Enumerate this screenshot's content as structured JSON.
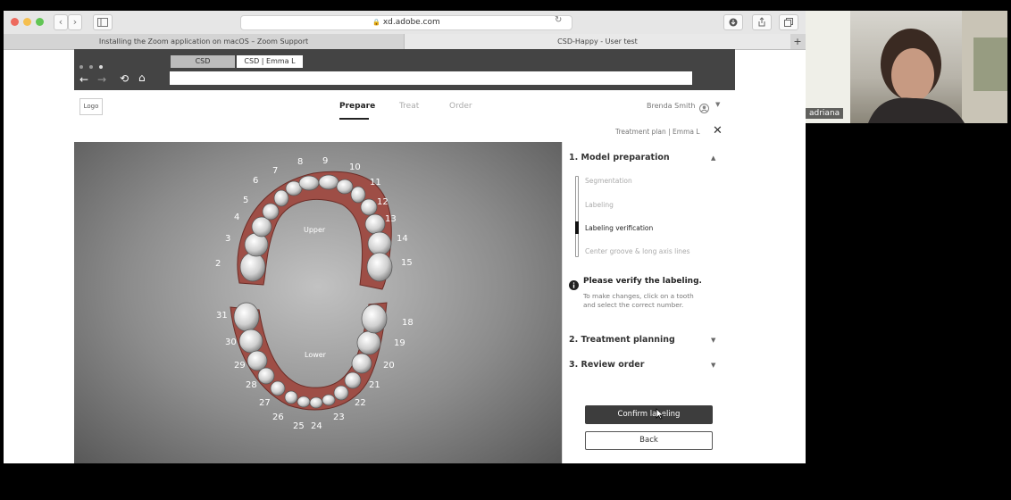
{
  "browser": {
    "address": "xd.adobe.com",
    "tabs": [
      "Installing the Zoom application on macOS – Zoom Support",
      "CSD-Happy - User test"
    ],
    "new_tab_symbol": "+"
  },
  "app_chrome": {
    "tabs": [
      "CSD",
      "CSD | Emma L"
    ]
  },
  "app": {
    "logo": "Logo",
    "nav": [
      "Prepare",
      "Treat",
      "Order"
    ],
    "active_nav": "Prepare",
    "user_name": "Brenda Smith",
    "breadcrumb": "Treatment plan | Emma L",
    "close_symbol": "✕"
  },
  "viewer": {
    "upper_label": "Upper",
    "lower_label": "Lower",
    "upper_numbers": [
      "2",
      "3",
      "4",
      "5",
      "6",
      "7",
      "8",
      "9",
      "10",
      "11",
      "12",
      "13",
      "14",
      "15"
    ],
    "lower_numbers": [
      "18",
      "19",
      "20",
      "21",
      "22",
      "23",
      "24",
      "25",
      "26",
      "27",
      "28",
      "29",
      "30",
      "31"
    ]
  },
  "panel": {
    "section1": "1. Model preparation",
    "steps": [
      {
        "label": "Segmentation",
        "active": false
      },
      {
        "label": "Labeling",
        "active": false
      },
      {
        "label": "Labeling verification",
        "active": true
      },
      {
        "label": "Center groove & long axis lines",
        "active": false
      }
    ],
    "info_title": "Please verify the labeling.",
    "info_text": "To make changes, click on a tooth and select the correct number.",
    "section2": "2. Treatment planning",
    "section3": "3. Review order",
    "confirm_label": "Confirm labeling",
    "back_label": "Back"
  },
  "video": {
    "participant": "adriana"
  },
  "colors": {
    "dark_button": "#3d3d3d",
    "app_chrome": "#444444",
    "gum": "#a5574f"
  }
}
